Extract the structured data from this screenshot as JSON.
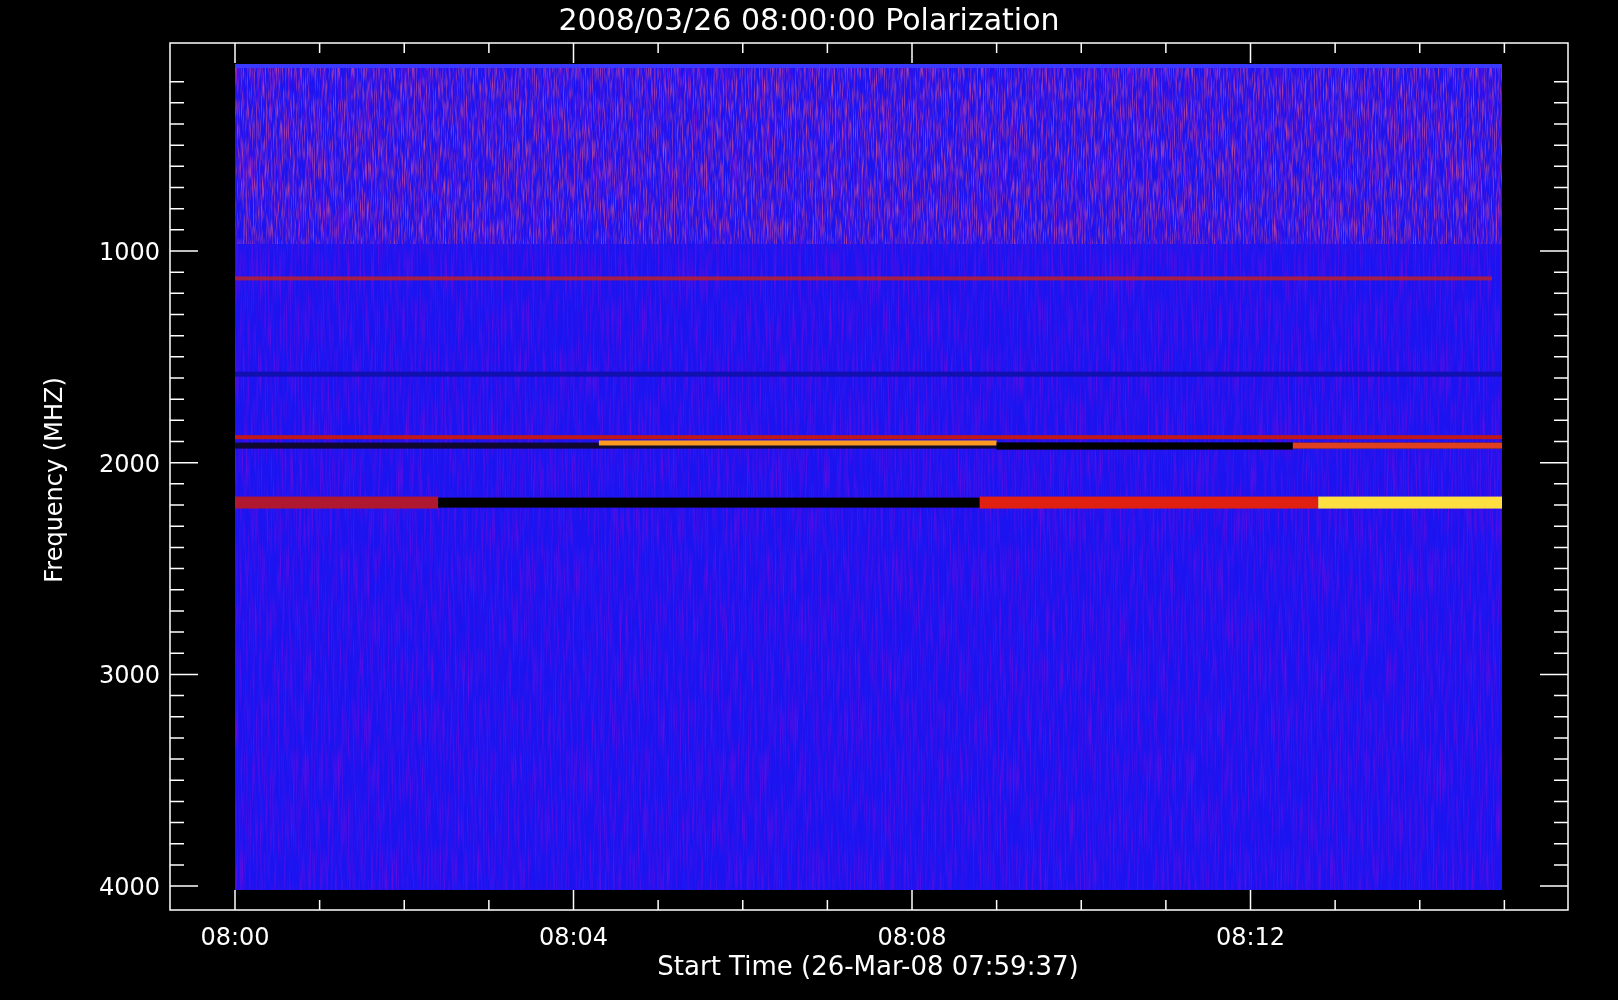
{
  "title": "2008/03/26 08:00:00 Polarization",
  "x_axis": {
    "label": "Start Time (26-Mar-08 07:59:37)",
    "ticks": [
      "08:00",
      "08:04",
      "08:08",
      "08:12"
    ]
  },
  "y_axis": {
    "label": "Frequency (MHZ)",
    "ticks": [
      "1000",
      "2000",
      "3000",
      "4000"
    ]
  }
}
